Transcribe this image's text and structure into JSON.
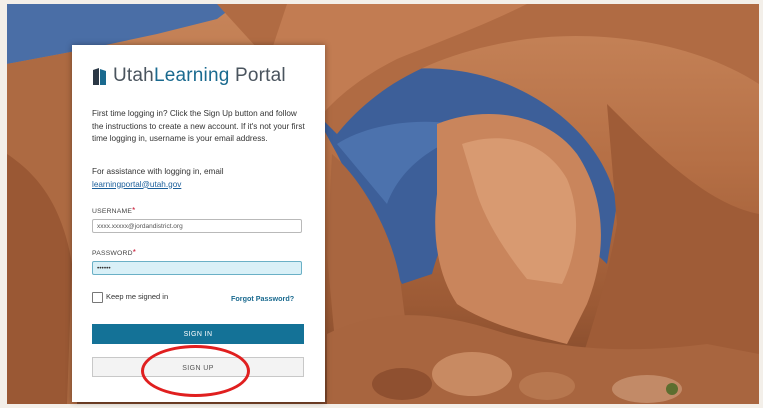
{
  "logo": {
    "word_utah": "Utah",
    "word_learning": "Learning",
    "word_portal": "Portal"
  },
  "intro_text": "First time logging in? Click the Sign Up button and follow the instructions to create a new account. If it's not your first time logging in, username is your email address.",
  "assistance": {
    "text": "For assistance with logging in, email",
    "email": "learningportal@utah.gov"
  },
  "username": {
    "label": "USERNAME",
    "required_mark": "*",
    "value": "xxxx.xxxxx@jordandistrict.org"
  },
  "password": {
    "label": "PASSWORD",
    "required_mark": "*",
    "value": "••••••"
  },
  "keep_signed_in": {
    "label": "Keep me signed in",
    "checked": false
  },
  "forgot_password": "Forgot Password?",
  "buttons": {
    "sign_in": "SIGN IN",
    "sign_up": "SIGN UP"
  },
  "colors": {
    "primary": "#147297",
    "annotation": "#e01f1f"
  }
}
